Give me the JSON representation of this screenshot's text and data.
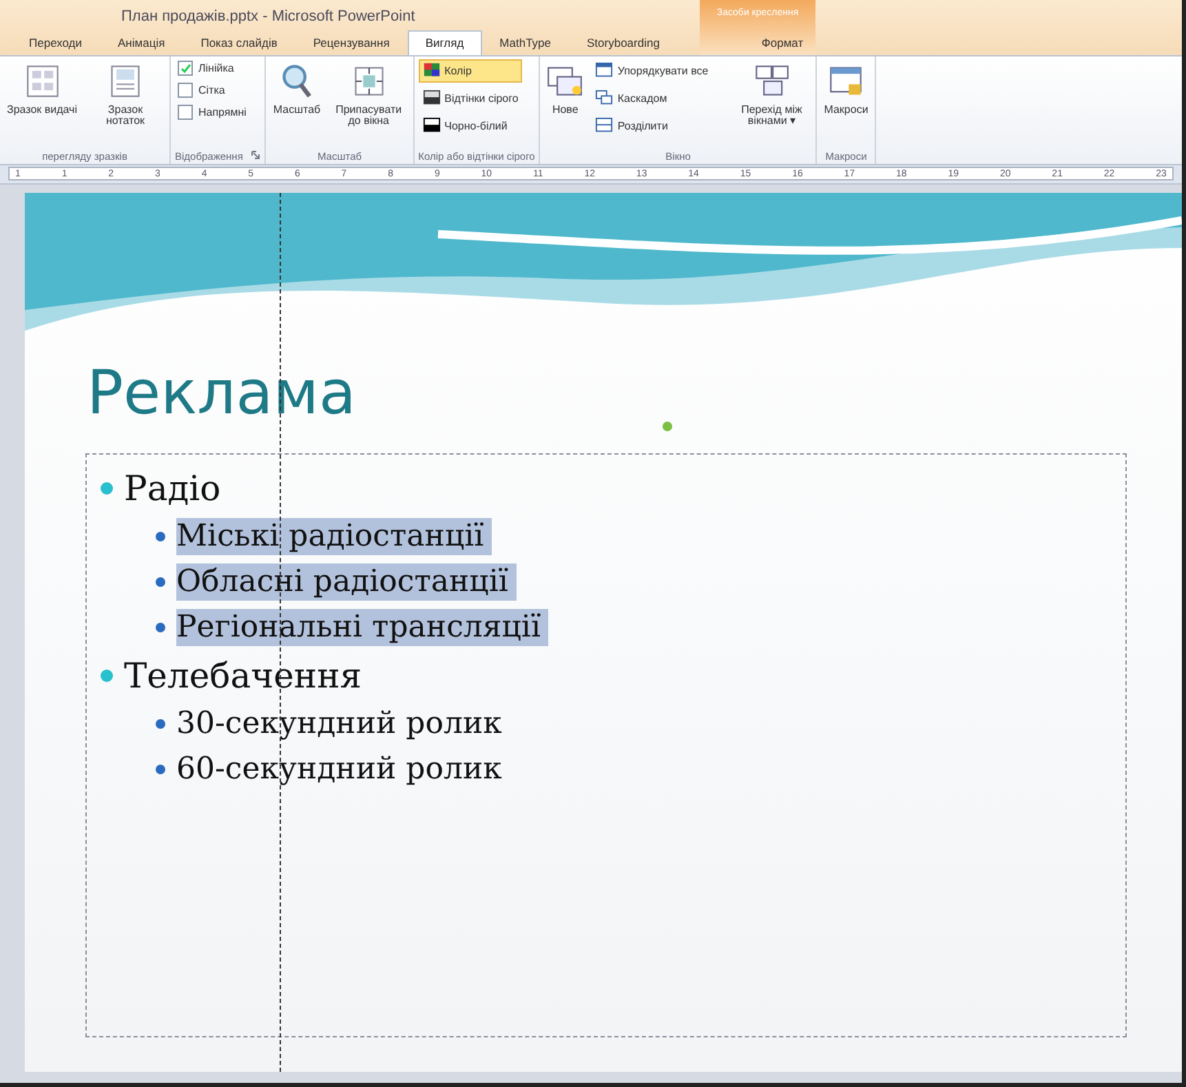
{
  "window": {
    "title": "План продажів.pptx - Microsoft PowerPoint",
    "context_tab_group": "Засоби креслення"
  },
  "tabs": [
    {
      "label": "Переходи",
      "selected": false
    },
    {
      "label": "Анімація",
      "selected": false
    },
    {
      "label": "Показ слайдів",
      "selected": false
    },
    {
      "label": "Рецензування",
      "selected": false
    },
    {
      "label": "Вигляд",
      "selected": true
    },
    {
      "label": "MathType",
      "selected": false
    },
    {
      "label": "Storyboarding",
      "selected": false
    },
    {
      "label": "Формат",
      "selected": false
    }
  ],
  "ribbon": [
    {
      "label": "переглядy зразків",
      "kind": "big",
      "items": [
        {
          "label": "Зразок видачі"
        },
        {
          "label": "Зразок нотаток"
        }
      ]
    },
    {
      "label": "Відображення",
      "launcher": true,
      "kind": "checks",
      "items": [
        {
          "label": "Лінійка",
          "checked": true
        },
        {
          "label": "Сітка",
          "checked": false
        },
        {
          "label": "Напрямні",
          "checked": false
        }
      ]
    },
    {
      "label": "Масштаб",
      "kind": "big",
      "items": [
        {
          "label": "Масштаб"
        },
        {
          "label": "Припасувати до вікна"
        }
      ]
    },
    {
      "label": "Колір або відтінки сірого",
      "kind": "list",
      "items": [
        {
          "label": "Колір",
          "selected": true
        },
        {
          "label": "Відтінки сірого",
          "selected": false
        },
        {
          "label": "Чорно-білий",
          "selected": false
        }
      ]
    },
    {
      "label": "Вікно",
      "kind": "window",
      "items": [
        {
          "label": "Нове"
        },
        {
          "label": "Упорядкувати все"
        },
        {
          "label": "Каскадом"
        },
        {
          "label": "Розділити"
        },
        {
          "label": "Перехід між вікнами ▾"
        }
      ]
    },
    {
      "label": "Макроси",
      "kind": "big",
      "items": [
        {
          "label": "Макроси"
        }
      ]
    }
  ],
  "ruler": [
    "1",
    "1",
    "2",
    "3",
    "4",
    "5",
    "6",
    "7",
    "8",
    "9",
    "10",
    "11",
    "12",
    "13",
    "14",
    "15",
    "16",
    "17",
    "18",
    "19",
    "20",
    "21",
    "22",
    "23"
  ],
  "slide": {
    "title": "Реклама",
    "bullets": [
      {
        "text": "Радіо",
        "selected": false,
        "children": [
          {
            "text": "Міські радіостанції",
            "selected": true
          },
          {
            "text": "Обласні радіостанції",
            "selected": true
          },
          {
            "text": "Регіональні трансляції",
            "selected": true
          }
        ]
      },
      {
        "text": "Телебачення",
        "selected": false,
        "children": [
          {
            "text": "30-секундний ролик",
            "selected": false
          },
          {
            "text": "60-секундний ролик",
            "selected": false
          }
        ]
      }
    ]
  }
}
